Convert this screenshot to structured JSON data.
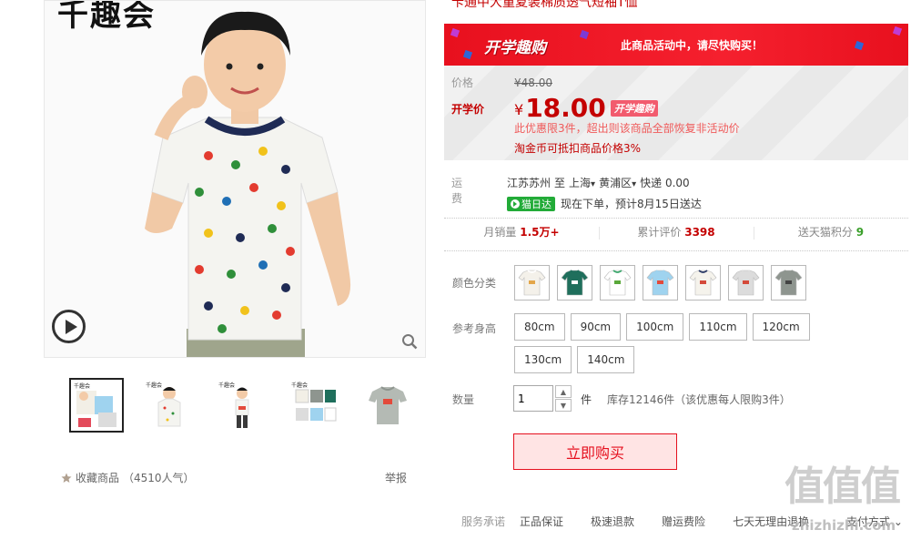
{
  "gallery": {
    "brand_text": "千趣会",
    "thumbnails": [
      {
        "tag": "千趣会",
        "active": true
      },
      {
        "tag": "千趣会",
        "active": false
      },
      {
        "tag": "千趣会",
        "active": false
      },
      {
        "tag": "千趣会",
        "active": false
      },
      {
        "tag": "",
        "active": false
      }
    ],
    "favorite_label": "收藏商品",
    "favorite_count": "（4510人气）",
    "report_label": "举报"
  },
  "product": {
    "title": "卡通中大童夏装棉质透气短袖T恤"
  },
  "promo": {
    "logo_text": "开学趣购",
    "banner_text": "此商品活动中，请尽快购买！",
    "colors": {
      "red": "#e8101e",
      "accent": "#c40000"
    }
  },
  "price": {
    "original_label": "价格",
    "original_value": "¥48.00",
    "sale_label": "开学价",
    "currency": "¥",
    "sale_value": "18.00",
    "sale_badge": "开学趣购",
    "limit_note": "此优惠限3件，超出则该商品全部恢复非活动价",
    "coin_note": "淘金币可抵扣商品价格3%"
  },
  "shipping": {
    "label": "运费",
    "from": "江苏苏州",
    "to_word": "至",
    "to_city": "上海",
    "to_district": "黄浦区",
    "method": "快递 0.00",
    "badge": "猫日达",
    "delivery_note": "现在下单，预计8月15日送达"
  },
  "stats": {
    "monthly_sales_label": "月销量",
    "monthly_sales_value": "1.5万+",
    "reviews_label": "累计评价",
    "reviews_value": "3398",
    "points_label": "送天猫积分",
    "points_value": "9"
  },
  "options": {
    "color_label": "颜色分类",
    "colors": [
      {
        "name": "white-dino",
        "shirt": "#f4f1ea",
        "trim": "#ffffff",
        "print": "#e3a64a"
      },
      {
        "name": "green",
        "shirt": "#1f6f5c",
        "trim": "#1f6f5c",
        "print": "#ffffff"
      },
      {
        "name": "white-green-collar",
        "shirt": "#ffffff",
        "trim": "#3aa66b",
        "print": "#5aa83a"
      },
      {
        "name": "light-blue",
        "shirt": "#9fd3ef",
        "trim": "#9fd3ef",
        "print": "#e34a3b"
      },
      {
        "name": "white-navy-collar",
        "shirt": "#f5f3ec",
        "trim": "#2b3a66",
        "print": "#d44a3a"
      },
      {
        "name": "light-gray",
        "shirt": "#dcdcdc",
        "trim": "#dcdcdc",
        "print": "#d44a3a"
      },
      {
        "name": "gray",
        "shirt": "#8e958f",
        "trim": "#8e958f",
        "print": "#444444"
      }
    ],
    "size_label": "参考身高",
    "sizes": [
      "80cm",
      "90cm",
      "100cm",
      "110cm",
      "120cm",
      "130cm",
      "140cm"
    ]
  },
  "quantity": {
    "label": "数量",
    "value": "1",
    "unit": "件",
    "stock_note": "库存12146件（该优惠每人限购3件）"
  },
  "buy_button": "立即购买",
  "services": {
    "label": "服务承诺",
    "items": [
      "正品保证",
      "极速退款",
      "赠运费险",
      "七天无理由退换"
    ],
    "payment": "支付方式"
  },
  "watermark": {
    "url": "zhizhizhi.com"
  }
}
